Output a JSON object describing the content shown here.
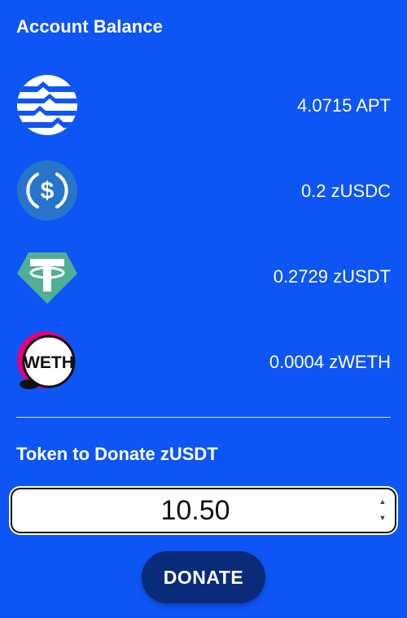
{
  "header": {
    "title": "Account Balance"
  },
  "balances": [
    {
      "icon": "aptos-logo-icon",
      "amount": "4.0715 APT"
    },
    {
      "icon": "usdc-logo-icon",
      "amount": "0.2 zUSDC"
    },
    {
      "icon": "tether-logo-icon",
      "amount": "0.2729 zUSDT"
    },
    {
      "icon": "weth-logo-icon",
      "amount": "0.0004 zWETH",
      "icon_text": "WETH"
    }
  ],
  "donate": {
    "label": "Token to Donate zUSDT",
    "value": "10.50",
    "button_label": "DONATE"
  },
  "colors": {
    "background": "#0d55f5",
    "button": "#0a2a7a",
    "usdc": "#2775ca",
    "tether": "#50af95",
    "weth_accent": "#e6007a"
  }
}
